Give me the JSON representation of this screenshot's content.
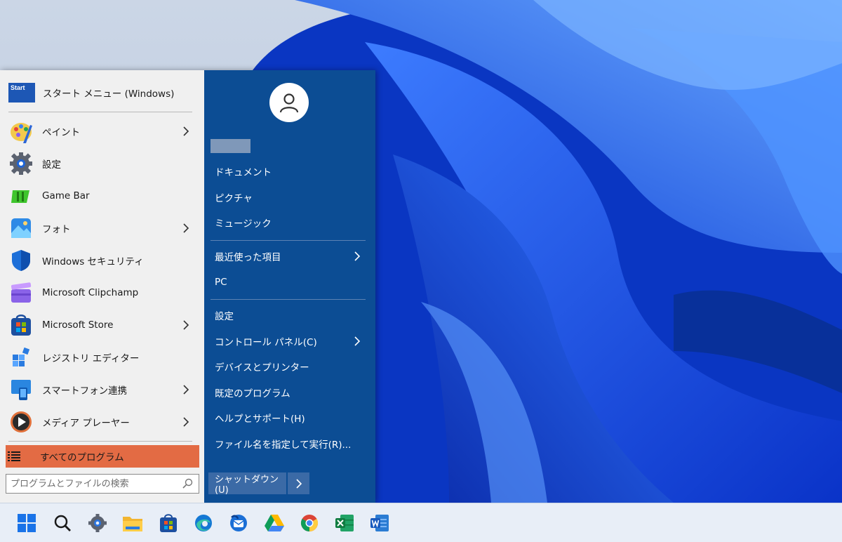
{
  "start_menu": {
    "header": {
      "label": "スタート メニュー (Windows)",
      "icon_text": "Start"
    },
    "programs": [
      {
        "label": "ペイント",
        "icon": "paint-icon",
        "has_submenu": true
      },
      {
        "label": "設定",
        "icon": "settings-gear-icon",
        "has_submenu": false
      },
      {
        "label": "Game Bar",
        "icon": "game-bar-icon",
        "has_submenu": false
      },
      {
        "label": "フォト",
        "icon": "photos-icon",
        "has_submenu": true
      },
      {
        "label": "Windows セキュリティ",
        "icon": "windows-security-shield-icon",
        "has_submenu": false
      },
      {
        "label": "Microsoft Clipchamp",
        "icon": "clipchamp-icon",
        "has_submenu": false
      },
      {
        "label": "Microsoft Store",
        "icon": "store-bag-icon",
        "has_submenu": true
      },
      {
        "label": "レジストリ エディター",
        "icon": "registry-editor-icon",
        "has_submenu": false
      },
      {
        "label": "スマートフォン連携",
        "icon": "phone-link-icon",
        "has_submenu": true
      },
      {
        "label": "メディア プレーヤー",
        "icon": "media-player-icon",
        "has_submenu": true
      }
    ],
    "all_programs": "すべてのプログラム",
    "search_placeholder": "プログラムとファイルの検索",
    "right_items": [
      {
        "label": "ドキュメント",
        "has_submenu": false
      },
      {
        "label": "ピクチャ",
        "has_submenu": false
      },
      {
        "label": "ミュージック",
        "has_submenu": false
      },
      {
        "label": "最近使った項目",
        "has_submenu": true
      },
      {
        "label": "PC",
        "has_submenu": false
      },
      {
        "label": "設定",
        "has_submenu": false
      },
      {
        "label": "コントロール パネル(C)",
        "has_submenu": true
      },
      {
        "label": "デバイスとプリンター",
        "has_submenu": false
      },
      {
        "label": "既定のプログラム",
        "has_submenu": false
      },
      {
        "label": "ヘルプとサポート(H)",
        "has_submenu": false
      },
      {
        "label": "ファイル名を指定して実行(R)...",
        "has_submenu": false
      }
    ],
    "shutdown_label": "シャットダウン(U)"
  },
  "taskbar": {
    "icons": [
      "windows-start-icon",
      "search-icon",
      "settings-icon",
      "file-explorer-icon",
      "microsoft-store-icon",
      "edge-icon",
      "thunderbird-icon",
      "google-drive-icon",
      "chrome-icon",
      "excel-icon",
      "word-icon"
    ]
  },
  "colors": {
    "left_pane": "#f0f0f0",
    "right_pane": "#0c4d94",
    "all_programs_accent": "#e36b44",
    "taskbar": "#e8eef7"
  }
}
